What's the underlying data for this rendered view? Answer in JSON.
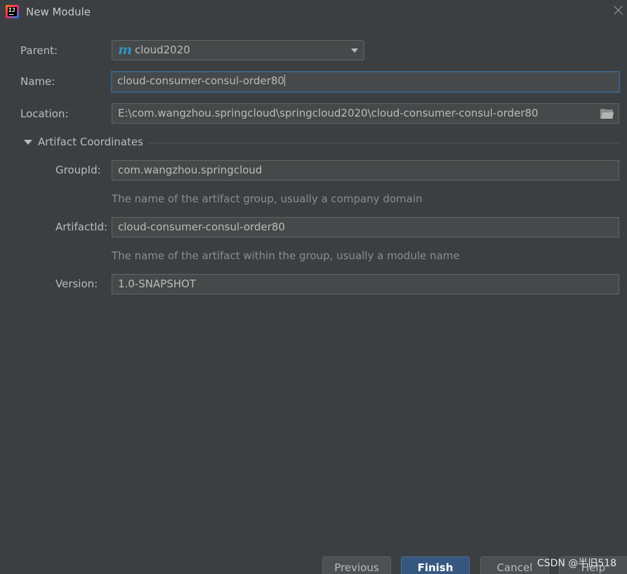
{
  "window": {
    "title": "New Module"
  },
  "form": {
    "parent": {
      "label": "Parent:",
      "value": "cloud2020",
      "icon": "maven-m-icon"
    },
    "name": {
      "label": "Name:",
      "value": "cloud-consumer-consul-order80"
    },
    "location": {
      "label": "Location:",
      "value": "E:\\com.wangzhou.springcloud\\springcloud2020\\cloud-consumer-consul-order80"
    }
  },
  "artifact": {
    "title": "Artifact Coordinates",
    "group_id": {
      "label": "GroupId:",
      "value": "com.wangzhou.springcloud",
      "hint": "The name of the artifact group, usually a company domain"
    },
    "artifact_id": {
      "label": "ArtifactId:",
      "value": "cloud-consumer-consul-order80",
      "hint": "The name of the artifact within the group, usually a module name"
    },
    "version": {
      "label": "Version:",
      "value": "1.0-SNAPSHOT"
    }
  },
  "buttons": {
    "previous": "Previous",
    "finish": "Finish",
    "cancel": "Cancel",
    "help": "Help"
  },
  "watermark": "CSDN @半旧518",
  "colors": {
    "background": "#3c3f41",
    "field": "#45494a",
    "focus_border": "#3d6185",
    "primary_button": "#365880",
    "maven_icon": "#3592c4"
  }
}
